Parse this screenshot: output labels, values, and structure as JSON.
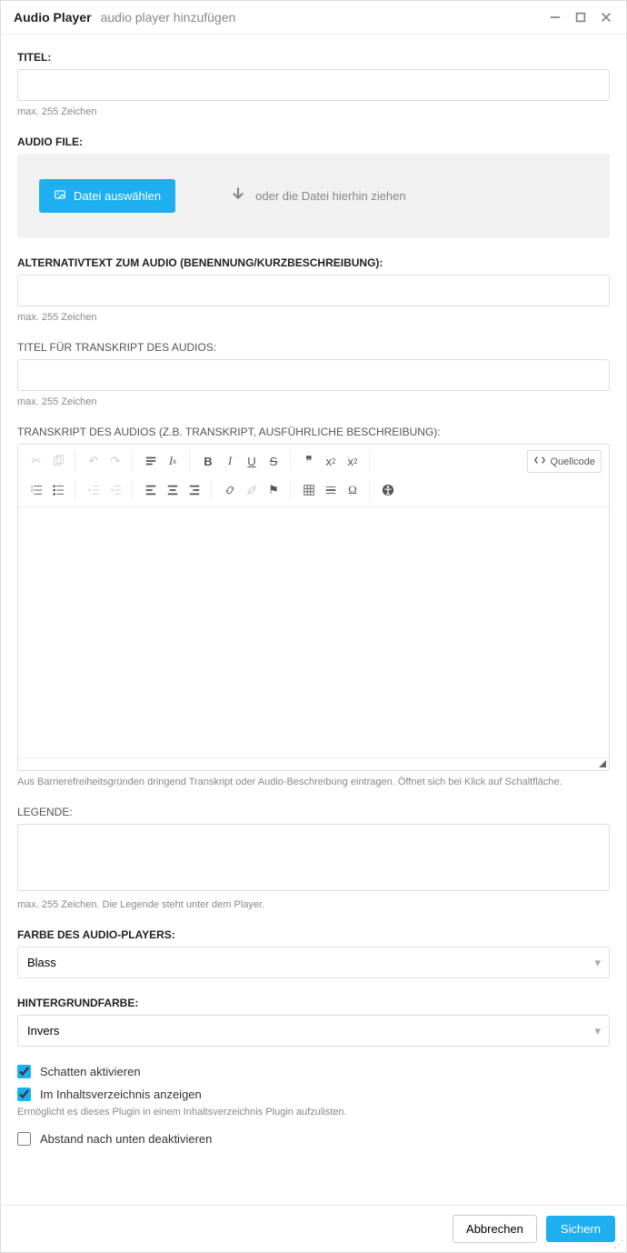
{
  "header": {
    "title": "Audio Player",
    "subtitle": "audio player hinzufügen"
  },
  "titel": {
    "label": "Titel:",
    "value": "",
    "hint": "max. 255 Zeichen"
  },
  "audiofile": {
    "label": "Audio File:",
    "button": "Datei auswählen",
    "drag": "oder die Datei hierhin ziehen"
  },
  "alt": {
    "label": "Alternativtext zum Audio (Benennung/Kurzbeschreibung):",
    "value": "",
    "hint": "max. 255 Zeichen"
  },
  "transtitle": {
    "label": "Titel für Transkript des Audios:",
    "value": "",
    "hint": "max. 255 Zeichen"
  },
  "transcript": {
    "label": "Transkript des Audios (z.B. Transkript, ausführliche Beschreibung):",
    "source": "Quellcode",
    "hint": "Aus Barrierefreiheitsgründen dringend Transkript oder Audio-Beschreibung eintragen. Öffnet sich bei Klick auf Schaltfläche."
  },
  "legende": {
    "label": "Legende:",
    "value": "",
    "hint": "max. 255 Zeichen. Die Legende steht unter dem Player."
  },
  "farbe": {
    "label": "Farbe des Audio-Players:",
    "value": "Blass"
  },
  "hintergrund": {
    "label": "Hintergrundfarbe:",
    "value": "Invers"
  },
  "chk_schatten": {
    "label": "Schatten aktivieren",
    "checked": true
  },
  "chk_inhalt": {
    "label": "Im Inhaltsverzeichnis anzeigen",
    "checked": true,
    "hint": "Ermöglicht es dieses Plugin in einem Inhaltsverzeichnis Plugin aufzulisten."
  },
  "chk_abstand": {
    "label": "Abstand nach unten deaktivieren",
    "checked": false
  },
  "footer": {
    "cancel": "Abbrechen",
    "save": "Sichern"
  }
}
